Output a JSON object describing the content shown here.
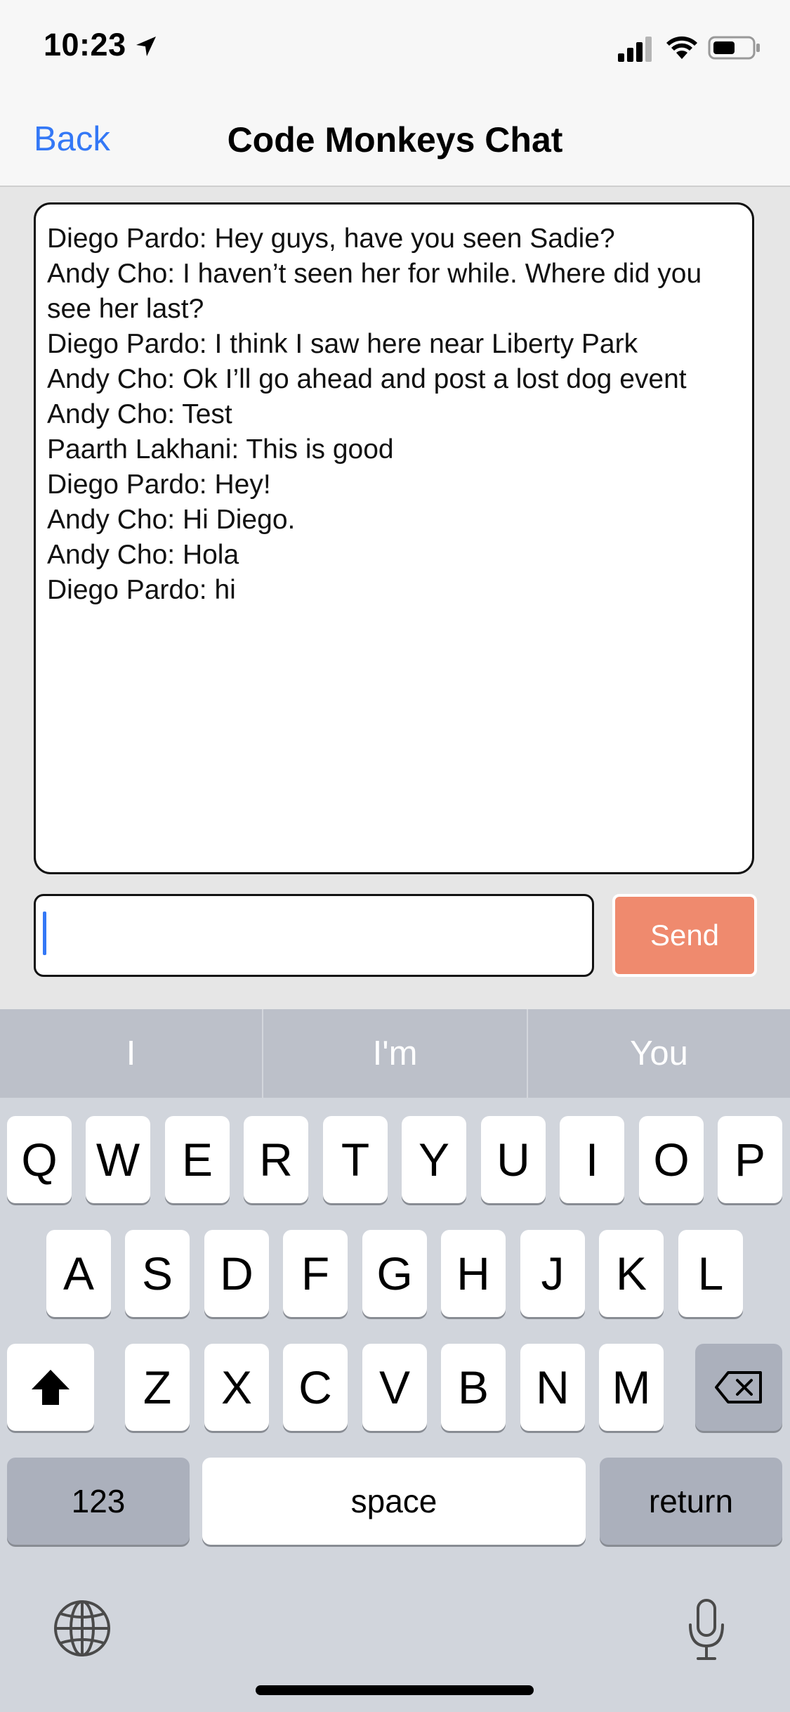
{
  "status_bar": {
    "time": "10:23",
    "icons": [
      "location-arrow-icon",
      "cellular-signal-icon",
      "wifi-icon",
      "battery-icon"
    ]
  },
  "nav": {
    "back_label": "Back",
    "title": "Code Monkeys Chat"
  },
  "chat": {
    "messages": [
      "Diego Pardo: Hey guys, have you seen Sadie?",
      "Andy Cho: I haven’t seen her for while. Where did you see her last?",
      "Diego Pardo: I think I saw here near Liberty Park",
      "Andy Cho: Ok I’ll go ahead and post a lost dog event",
      "Andy Cho: Test",
      "Paarth Lakhani: This is good",
      "Diego Pardo: Hey!",
      "Andy Cho: Hi Diego.",
      "Andy Cho: Hola",
      "Diego Pardo: hi"
    ]
  },
  "composer": {
    "input_value": "",
    "send_label": "Send",
    "send_color": "#ef8a6e"
  },
  "keyboard": {
    "suggestions": [
      "I",
      "I'm",
      "You"
    ],
    "row1": [
      "Q",
      "W",
      "E",
      "R",
      "T",
      "Y",
      "U",
      "I",
      "O",
      "P"
    ],
    "row2": [
      "A",
      "S",
      "D",
      "F",
      "G",
      "H",
      "J",
      "K",
      "L"
    ],
    "row3": [
      "Z",
      "X",
      "C",
      "V",
      "B",
      "N",
      "M"
    ],
    "numbers_label": "123",
    "space_label": "space",
    "return_label": "return"
  },
  "colors": {
    "accent": "#3478f6",
    "keyboard_bg": "#d1d5dc"
  }
}
